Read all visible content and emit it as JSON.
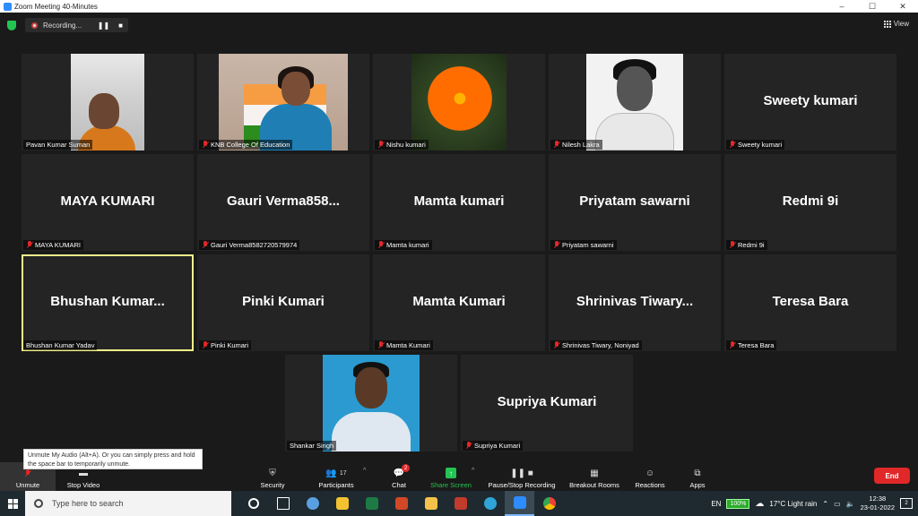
{
  "window": {
    "title": "Zoom Meeting 40-Minutes",
    "controls": [
      "–",
      "☐",
      "✕"
    ]
  },
  "recording": {
    "label": "Recording...",
    "pause": "❚❚",
    "stop": "■"
  },
  "view_label": "View",
  "tiles": [
    {
      "big": "",
      "label": "Pavan Kumar Suman",
      "muted": false
    },
    {
      "big": "",
      "label": "KNB College Of Education",
      "muted": true
    },
    {
      "big": "",
      "label": "Nishu kumari",
      "muted": true
    },
    {
      "big": "",
      "label": "Nilesh Lakra",
      "muted": true
    },
    {
      "big": "Sweety kumari",
      "label": "Sweety kumari",
      "muted": true
    },
    {
      "big": "MAYA KUMARI",
      "label": "MAYA KUMARI",
      "muted": true
    },
    {
      "big": "Gauri  Verma858...",
      "label": "Gauri Verma8582720579974",
      "muted": true
    },
    {
      "big": "Mamta kumari",
      "label": "Mamta kumari",
      "muted": true
    },
    {
      "big": "Priyatam sawarni",
      "label": "Priyatam sawarni",
      "muted": true
    },
    {
      "big": "Redmi 9i",
      "label": "Redmi 9i",
      "muted": true
    },
    {
      "big": "Bhushan  Kumar...",
      "label": "Bhushan Kumar Yadav",
      "muted": false
    },
    {
      "big": "Pinki Kumari",
      "label": "Pinki Kumari",
      "muted": true
    },
    {
      "big": "Mamta Kumari",
      "label": "Mamta Kumari",
      "muted": true
    },
    {
      "big": "Shrinivas  Tiwary...",
      "label": "Shrinivas Tiwary, Noniyad",
      "muted": true
    },
    {
      "big": "Teresa Bara",
      "label": "Teresa Bara",
      "muted": true
    },
    {
      "big": "",
      "label": "Shankar Singh",
      "muted": false
    },
    {
      "big": "Supriya Kumari",
      "label": "Supriya Kumari",
      "muted": true
    }
  ],
  "tooltip": "Unmute My Audio (Alt+A). Or you can simply press and hold the space bar to temporarily unmute.",
  "toolbar": {
    "unmute": "Unmute",
    "stop_video": "Stop Video",
    "security": "Security",
    "participants": "Participants",
    "participants_count": "17",
    "chat": "Chat",
    "chat_badge": "2",
    "share_screen": "Share Screen",
    "pause_stop_recording": "Pause/Stop Recording",
    "breakout_rooms": "Breakout Rooms",
    "reactions": "Reactions",
    "apps": "Apps",
    "end": "End"
  },
  "taskbar": {
    "search_placeholder": "Type here to search",
    "language": "EN",
    "battery": "100%",
    "weather": "17°C  Light rain",
    "time": "12:38",
    "date": "23-01-2022",
    "notifications": "2"
  },
  "colors": {
    "active_speaker": "#f1f18a",
    "end": "#e02828",
    "share": "#23c552",
    "accent": "#2d8cff"
  }
}
